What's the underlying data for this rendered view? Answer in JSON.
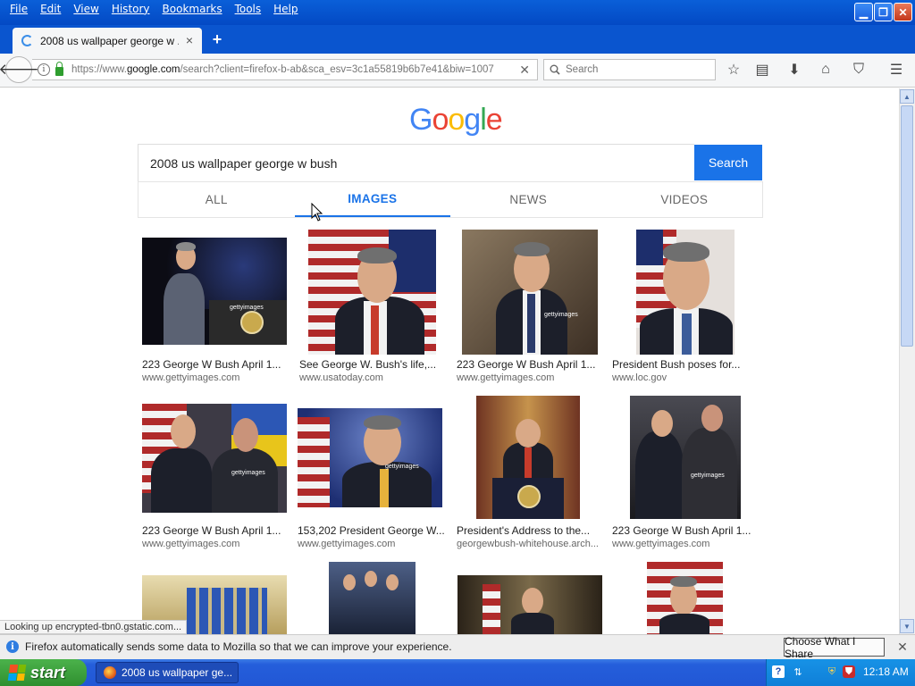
{
  "menu": [
    "File",
    "Edit",
    "View",
    "History",
    "Bookmarks",
    "Tools",
    "Help"
  ],
  "tab": {
    "title": "2008 us wallpaper george w ...",
    "close": "×",
    "new": "+"
  },
  "nav": {
    "url_scheme": "https://www.",
    "url_domain": "google.com",
    "url_path": "/search?client=firefox-b-ab&sca_esv=3c1a55819b6b7e41&biw=1007",
    "search_placeholder": "Search"
  },
  "page": {
    "logo": [
      "G",
      "o",
      "o",
      "g",
      "l",
      "e"
    ],
    "logo_colors": [
      "#4285F4",
      "#EA4335",
      "#FBBC05",
      "#4285F4",
      "#34A853",
      "#EA4335"
    ],
    "query": "2008 us wallpaper george w bush",
    "search_button": "Search",
    "tabs": [
      "ALL",
      "IMAGES",
      "NEWS",
      "VIDEOS"
    ],
    "active_tab": "IMAGES"
  },
  "results": [
    {
      "title": "223 George W Bush April 1...",
      "source": "www.gettyimages.com"
    },
    {
      "title": "See George W. Bush's life,...",
      "source": "www.usatoday.com"
    },
    {
      "title": "223 George W Bush April 1...",
      "source": "www.gettyimages.com"
    },
    {
      "title": "President Bush poses for...",
      "source": "www.loc.gov"
    },
    {
      "title": "223 George W Bush April 1...",
      "source": "www.gettyimages.com"
    },
    {
      "title": "153,202 President George W...",
      "source": "www.gettyimages.com"
    },
    {
      "title": "President's Address to the...",
      "source": "georgewbush-whitehouse.arch..."
    },
    {
      "title": "223 George W Bush April 1...",
      "source": "www.gettyimages.com"
    }
  ],
  "status_tip": "Looking up encrypted-tbn0.gstatic.com...",
  "notification": {
    "text": "Firefox automatically sends some data to Mozilla so that we can improve your experience.",
    "button": "Choose What I Share"
  },
  "taskbar": {
    "start": "start",
    "item": "2008 us wallpaper ge...",
    "clock": "12:18 AM"
  }
}
